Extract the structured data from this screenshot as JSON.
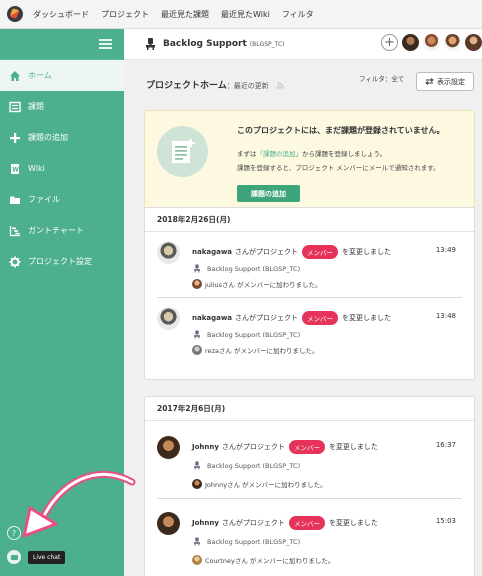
{
  "topnav": {
    "items": [
      "ダッシュボード",
      "プロジェクト",
      "最近見た課題",
      "最近見たWiki",
      "フィルタ"
    ]
  },
  "sidebar": {
    "items": [
      {
        "label": "ホーム",
        "icon": "home-icon"
      },
      {
        "label": "課題",
        "icon": "list-icon"
      },
      {
        "label": "課題の追加",
        "icon": "plus-icon"
      },
      {
        "label": "Wiki",
        "icon": "wiki-icon"
      },
      {
        "label": "ファイル",
        "icon": "folder-icon"
      },
      {
        "label": "ガントチャート",
        "icon": "gantt-icon"
      },
      {
        "label": "プロジェクト設定",
        "icon": "gear-icon"
      }
    ],
    "help": "?",
    "chat_tooltip": "Live chat"
  },
  "header": {
    "project_name": "Backlog Support",
    "project_key": "(BLGSP_TC)",
    "add": "+"
  },
  "content": {
    "title": "プロジェクトホーム",
    "subtitle": "：最近の更新",
    "filter": "フィルタ：全て",
    "display_button": "表示設定"
  },
  "empty": {
    "title": "このプロジェクトには、まだ課題が登録されていません。",
    "line1_prefix": "まずは",
    "line1_link": "「課題の追加」",
    "line1_suffix": "から課題を登録しましょう。",
    "line2": "課題を登録すると、プロジェクト メンバーにメールで通知されます。",
    "button": "課題の追加"
  },
  "feed": [
    {
      "date": "2018年2月26日(月)",
      "items": [
        {
          "user": "nakagawa",
          "pre": "さんがプロジェクト",
          "badge": "メンバー",
          "post": "を変更しました",
          "time": "13:49",
          "project": "Backlog Support (BLGSP_TC)",
          "member": "juliusさん がメンバーに加わりました。"
        },
        {
          "user": "nakagawa",
          "pre": "さんがプロジェクト",
          "badge": "メンバー",
          "post": "を変更しました",
          "time": "13:48",
          "project": "Backlog Support (BLGSP_TC)",
          "member": "rezaさん がメンバーに加わりました。"
        }
      ]
    },
    {
      "date": "2017年2月6日(月)",
      "items": [
        {
          "user": "Johnny",
          "pre": "さんがプロジェクト",
          "badge": "メンバー",
          "post": "を変更しました",
          "time": "16:37",
          "project": "Backlog Support (BLGSP_TC)",
          "member": "Johnnyさん がメンバーに加わりました。"
        },
        {
          "user": "Johnny",
          "pre": "さんがプロジェクト",
          "badge": "メンバー",
          "post": "を変更しました",
          "time": "15:03",
          "project": "Backlog Support (BLGSP_TC)",
          "member": "Courtneyさん がメンバーに加わりました。"
        }
      ]
    }
  ],
  "colors": {
    "brand": "#4caf8f",
    "badge": "#e6335a",
    "arrow": "#e94f86"
  }
}
